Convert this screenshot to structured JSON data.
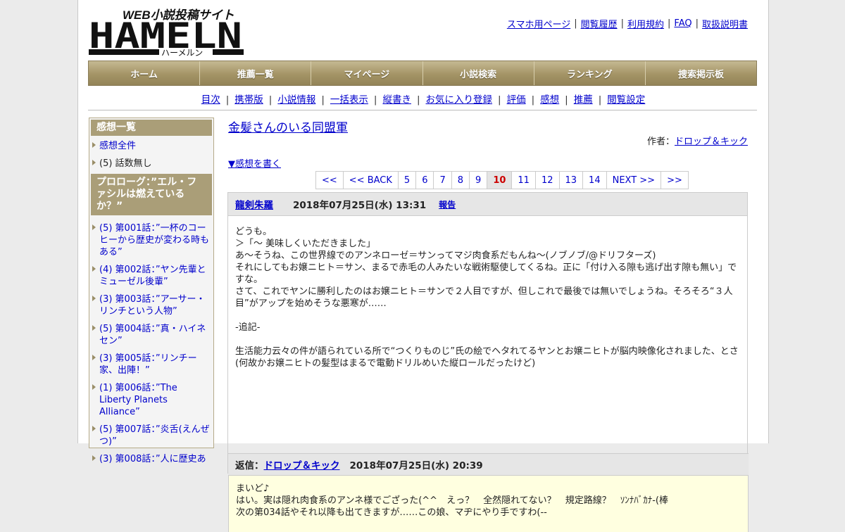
{
  "header": {
    "logo_tagline": "WEB小説投稿サイト",
    "logo_main": "HAMELN",
    "logo_sub": "ハーメルン",
    "top_links": [
      "スマホ用ページ",
      "閲覧履歴",
      "利用規約",
      "FAQ",
      "取扱説明書"
    ]
  },
  "main_nav": [
    "ホーム",
    "推薦一覧",
    "マイページ",
    "小説検索",
    "ランキング",
    "捜索掲示板"
  ],
  "sub_nav": [
    "目次",
    "携帯版",
    "小説情報",
    "一括表示",
    "縦書き",
    "お気に入り登録",
    "評価",
    "感想",
    "推薦",
    "閲覧設定"
  ],
  "sidebar": {
    "heading": "感想一覧",
    "items": [
      {
        "label": "感想全件",
        "link": true
      },
      {
        "label": "(5) 話数無し",
        "link": false
      }
    ],
    "section_heading": "プロローグ：”エル・ファシルは燃えているか？”",
    "chapters": [
      "(5) 第001話：”一杯のコーヒーから歴史が変わる時もある”",
      "(4) 第002話：”ヤン先輩とミューゼル後輩”",
      "(3) 第003話：”アーサー・リンチという人物”",
      "(5) 第004話：”真・ハイネセン”",
      "(3) 第005話：”リンチー家、出陣！”",
      "(1) 第006話：”The Liberty Planets Alliance”",
      "(5) 第007話：”炎舌(えんぜつ)”",
      "(3) 第008話：”人に歴史あ"
    ]
  },
  "main": {
    "title": "金髪さんのいる同盟軍",
    "author_label": "作者：",
    "author_name": "ドロップ＆キック",
    "write_link": "▼感想を書く",
    "pager": [
      "<<",
      "<< BACK",
      "5",
      "6",
      "7",
      "8",
      "9",
      "10",
      "11",
      "12",
      "13",
      "14",
      "NEXT >>",
      ">>"
    ],
    "pager_current": "10"
  },
  "comment": {
    "author": "龍剣朱羅",
    "date": "2018年07月25日(水) 13:31",
    "report": "報告",
    "lines": [
      "どうも。",
      "＞「～ 美味しくいただきました」",
      "あ～そうね、この世界線でのアンネローゼ＝サンってマジ肉食系だもんね～(ノブノブ/@ドリフターズ)",
      "それにしてもお嬢ニヒト＝サン、まるで赤毛の人みたいな戦術駆使してくるね。正に「付け入る隙も逃げ出す隙も無い」ですな。",
      "さて、これでヤンに勝利したのはお嬢ニヒト＝サンで２人目ですが、但しこれで最後では無いでしょうね。そろそろ“３人目”がアップを始めそうな悪寒が……",
      "",
      "-追記-",
      "",
      "生活能力云々の件が語られている所で“つくりものじ”氏の絵でヘタれてるヤンとお嬢ニヒトが脳内映像化されました、とさ(何故かお嬢ニヒトの髪型はまるで電動ドリルめいた縦ロールだったけど)"
    ]
  },
  "reply": {
    "label": "返信：",
    "author": "ドロップ＆キック",
    "date": "2018年07月25日(水) 20:39",
    "lines": [
      "まいど♪",
      "はい。実は隠れ肉食系のアンネ様でござった(^^　えっ？　全然隠れてない？　規定路線？　ｿﾝﾅﾊﾞｶﾅ-(棒",
      "次の第034話やそれ以降も出てきますが……この娘、マヂにやり手ですわ(--"
    ]
  }
}
